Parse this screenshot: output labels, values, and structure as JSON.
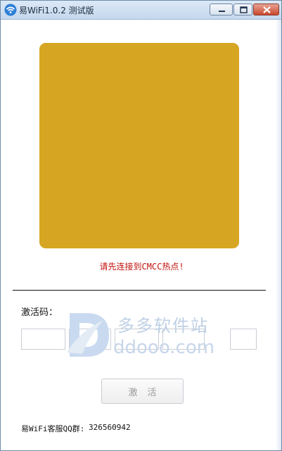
{
  "window": {
    "title": "易WiFi1.0.2 测试版"
  },
  "status": {
    "message": "请先连接到CMCC热点!"
  },
  "activation": {
    "label": "激活码：",
    "fields": [
      "",
      "",
      "",
      "",
      ""
    ],
    "button_label": "激活"
  },
  "footer": {
    "qq_label": "易WiFi客服QQ群:",
    "qq_number": "326560942"
  },
  "watermark": {
    "cn": "多多软件站",
    "en": "ddooo.com"
  },
  "colors": {
    "qr_placeholder": "#d6a623",
    "status_text": "#c0150f"
  },
  "icons": {
    "app": "wifi-icon",
    "minimize": "minimize-icon",
    "maximize": "maximize-icon",
    "close": "close-icon"
  }
}
